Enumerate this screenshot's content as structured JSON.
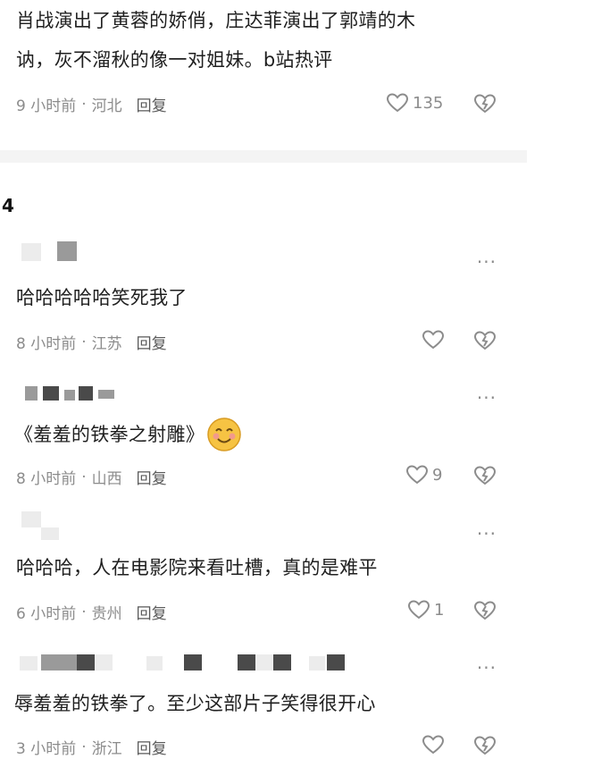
{
  "top_comment": {
    "text_line1": "肖战演出了黄蓉的娇俏，庄达菲演出了郭靖的木",
    "text_line2": "讷，灰不溜秋的像一对姐妹。b站热评",
    "time": "9 小时前",
    "location": "河北",
    "reply": "回复",
    "likes": "135"
  },
  "section": {
    "rank": "4"
  },
  "comments": [
    {
      "text": "哈哈哈哈哈笑死我了",
      "time": "8 小时前",
      "location": "江苏",
      "reply": "回复",
      "likes": ""
    },
    {
      "text": "《羞羞的铁拳之射雕》",
      "emoji": "😊",
      "time": "8 小时前",
      "location": "山西",
      "reply": "回复",
      "likes": "9"
    },
    {
      "text": "哈哈哈，人在电影院来看吐槽，真的是难平",
      "time": "6 小时前",
      "location": "贵州",
      "reply": "回复",
      "likes": "1"
    },
    {
      "text": "辱羞羞的铁拳了。至少这部片子笑得很开心",
      "time": "3 小时前",
      "location": "浙江",
      "reply": "回复",
      "likes": ""
    }
  ],
  "icons": {
    "like": "heart-icon",
    "dislike": "broken-heart-icon",
    "more": "more-dots-icon"
  },
  "ui": {
    "dot_sep": "·",
    "more_glyph": "···"
  }
}
